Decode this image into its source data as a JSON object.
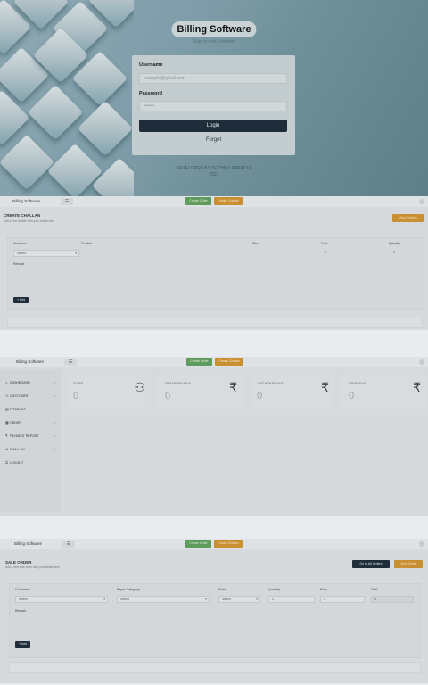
{
  "login": {
    "title": "Billing Software",
    "subtitle": "Sign in and Continue",
    "username_label": "Username",
    "username_placeholder": "example@gmail.com",
    "password_label": "Password",
    "password_value": "•••••••",
    "login_button": "Login",
    "forgot_link": "Forget",
    "credit_line1": "DEVELOPED BY TECHNO PARACLE",
    "credit_line2": "2021"
  },
  "topbar": {
    "brand": "Billing Software",
    "menu_icon": "☰",
    "create_order": "Create Order",
    "create_challan": "Create Challan"
  },
  "challan": {
    "title": "CREATE CHALLAN",
    "subtitle": "Add a new challan with your details here",
    "view_button": "View Challan",
    "fields": {
      "customer_label": "Customer*",
      "customer_value": "Select",
      "product_label": "Product",
      "size_label": "Size*",
      "price_label": "Price*",
      "price_value": "0",
      "quantity_label": "Quantity",
      "quantity_value": "1",
      "remark_label": "Remark"
    },
    "add_button": "+ Add"
  },
  "dashboard": {
    "brand": "Billing Software",
    "sidebar": [
      {
        "icon": "⌂",
        "label": "DASHBOARD"
      },
      {
        "icon": "☺",
        "label": "CUSTOMER"
      },
      {
        "icon": "▤",
        "label": "PRODUCT"
      },
      {
        "icon": "▦",
        "label": "ORDER"
      },
      {
        "icon": "₹",
        "label": "PAYMENT REPORT"
      },
      {
        "icon": "✔",
        "label": "CHALLAN"
      },
      {
        "icon": "⏻",
        "label": "LOGOUT"
      }
    ],
    "tiles": [
      {
        "label": "CLIENT",
        "value": "0",
        "icon": "⚇"
      },
      {
        "label": "THIS MONTH SALE",
        "value": "0",
        "icon": "₹"
      },
      {
        "label": "LAST MONTH SALE",
        "value": "0",
        "icon": "₹"
      },
      {
        "label": "TODAY SALE",
        "value": "0",
        "icon": "₹"
      }
    ]
  },
  "order": {
    "brand": "Billing Software",
    "title": "SALE ORDER",
    "subtitle": "Add a new sale order with your details here",
    "go_all_orders": "Go to All Orders",
    "view_order": "View Order",
    "fields": {
      "customer_label": "Customer*",
      "customer_value": "Select",
      "paper_label": "Paper Category*",
      "paper_value": "Select",
      "size_label": "Size*",
      "size_value": "Select",
      "quantity_label": "Quantity",
      "quantity_value": "1",
      "price_label": "Price",
      "price_value": "0",
      "total_label": "Total",
      "total_value": "0",
      "remark_label": "Remark"
    },
    "add_button": "+ Add"
  }
}
